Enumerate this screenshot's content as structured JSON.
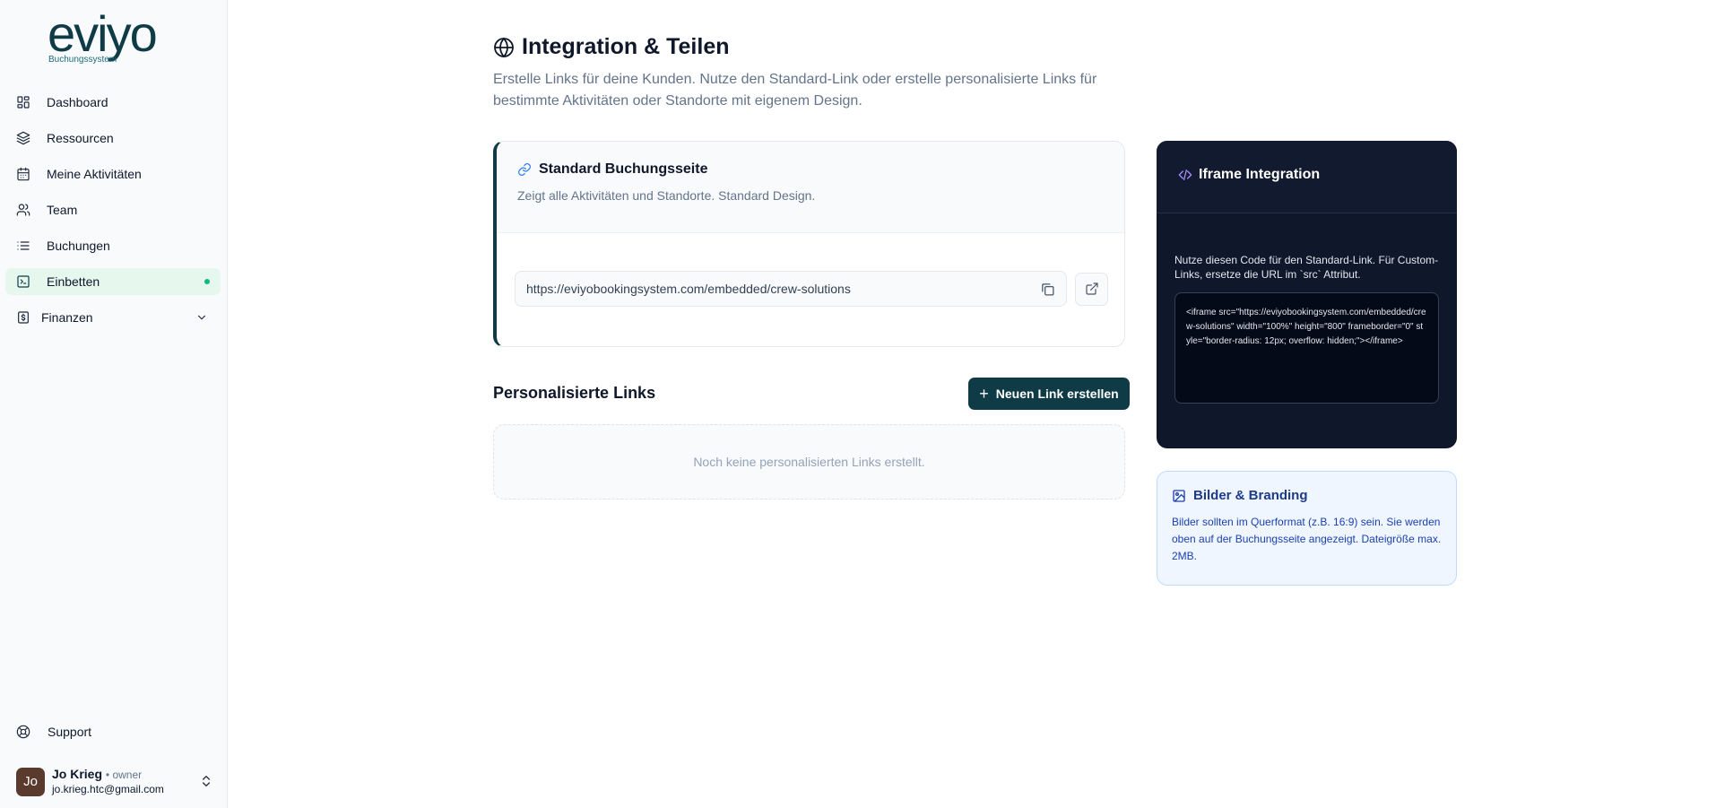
{
  "logo": {
    "word": "eviyo",
    "subtitle": "Buchungssystem"
  },
  "nav": {
    "items": [
      {
        "label": "Dashboard",
        "icon": "dashboard-icon"
      },
      {
        "label": "Ressourcen",
        "icon": "layers-icon"
      },
      {
        "label": "Meine Aktivitäten",
        "icon": "calendar-icon"
      },
      {
        "label": "Team",
        "icon": "users-icon"
      },
      {
        "label": "Buchungen",
        "icon": "list-icon"
      },
      {
        "label": "Einbetten",
        "icon": "embed-icon",
        "active": true
      },
      {
        "label": "Finanzen",
        "icon": "dollar-icon"
      }
    ]
  },
  "support": {
    "label": "Support"
  },
  "user": {
    "initials": "Jo",
    "name": "Jo Krieg",
    "role": "• owner",
    "email": "jo.krieg.htc@gmail.com"
  },
  "page": {
    "title": "Integration & Teilen",
    "description": "Erstelle Links für deine Kunden. Nutze den Standard-Link oder erstelle personalisierte Links für bestimmte Aktivitäten oder Standorte mit eigenem Design."
  },
  "standard": {
    "title": "Standard Buchungsseite",
    "subtitle": "Zeigt alle Aktivitäten und Standorte. Standard Design.",
    "url": "https://eviyobookingsystem.com/embedded/crew-solutions"
  },
  "personalized": {
    "title": "Personalisierte Links",
    "new_button": "Neuen Link erstellen",
    "empty_text": "Noch keine personalisierten Links erstellt."
  },
  "iframe": {
    "title": "Iframe Integration",
    "description": "Nutze diesen Code für den Standard-Link. Für Custom-Links, ersetze die URL im `src` Attribut.",
    "code": "<iframe src=\"https://eviyobookingsystem.com/embedded/crew-solutions\" width=\"100%\" height=\"800\" frameborder=\"0\" style=\"border-radius: 12px; overflow: hidden;\"></iframe>"
  },
  "branding": {
    "title": "Bilder & Branding",
    "text": "Bilder sollten im Querformat (z.B. 16:9) sein. Sie werden oben auf der Buchungsseite angezeigt. Dateigröße max. 2MB."
  },
  "colors": {
    "brand": "#0f3b46",
    "active_bg": "#e6f7ee",
    "active_dot": "#10b981",
    "dark_card": "#0f172a"
  }
}
